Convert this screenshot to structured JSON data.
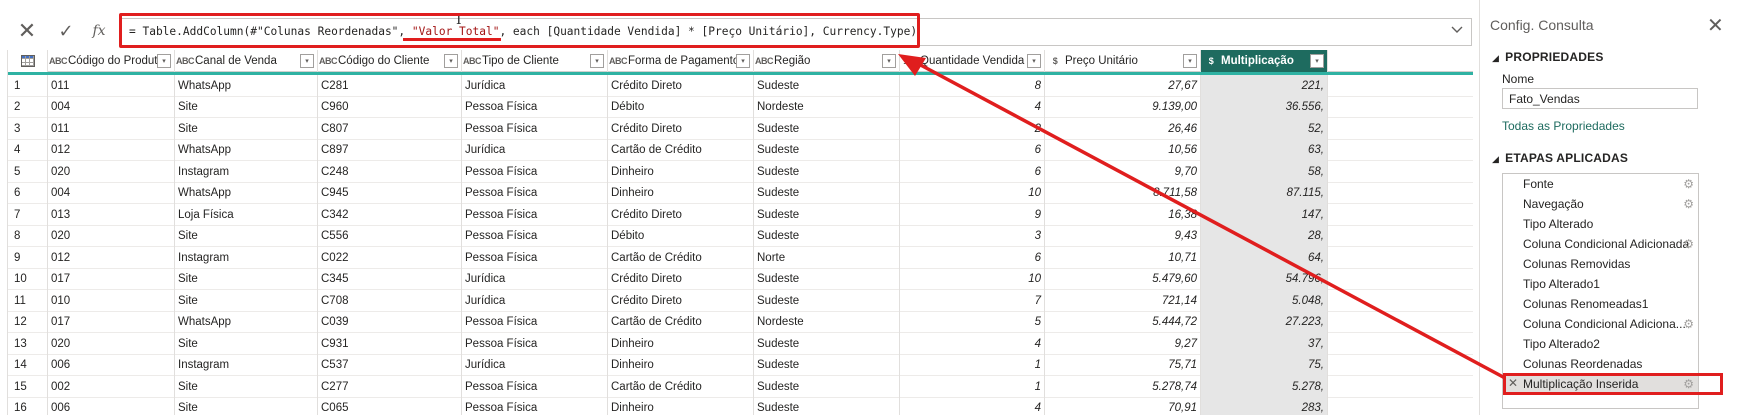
{
  "formula_bar": {
    "cancel_icon": "✕",
    "commit_icon": "✓",
    "fx_label": "fx",
    "formula_prefix": "= Table.AddColumn(#\"Colunas Reordenadas\", ",
    "formula_string": "\"Valor Total\"",
    "formula_suffix": ", each [Quantidade Vendida] * [Preço Unitário], Currency.Type)",
    "expand_icon": "chevron-down",
    "cursor_glyph": "I"
  },
  "grid": {
    "columns": [
      {
        "type": "ABC",
        "label": "Código do Produto"
      },
      {
        "type": "ABC",
        "label": "Canal de Venda"
      },
      {
        "type": "ABC",
        "label": "Código do Cliente"
      },
      {
        "type": "ABC",
        "label": "Tipo de Cliente"
      },
      {
        "type": "ABC",
        "label": "Forma de Pagamento"
      },
      {
        "type": "ABC",
        "label": "Região"
      },
      {
        "type": "123",
        "label": "Quantidade Vendida"
      },
      {
        "type": "$",
        "label": "Preço Unitário"
      },
      {
        "type": "$",
        "label": "Multiplicação"
      }
    ],
    "filter_glyph": "▾",
    "rows": [
      {
        "n": "1",
        "cells": [
          "011",
          "WhatsApp",
          "C281",
          "Jurídica",
          "Crédito Direto",
          "Sudeste",
          "8",
          "27,67",
          "221,"
        ]
      },
      {
        "n": "2",
        "cells": [
          "004",
          "Site",
          "C960",
          "Pessoa Física",
          "Débito",
          "Nordeste",
          "4",
          "9.139,00",
          "36.556,"
        ]
      },
      {
        "n": "3",
        "cells": [
          "011",
          "Site",
          "C807",
          "Pessoa Física",
          "Crédito Direto",
          "Sudeste",
          "2",
          "26,46",
          "52,"
        ]
      },
      {
        "n": "4",
        "cells": [
          "012",
          "WhatsApp",
          "C897",
          "Jurídica",
          "Cartão de Crédito",
          "Sudeste",
          "6",
          "10,56",
          "63,"
        ]
      },
      {
        "n": "5",
        "cells": [
          "020",
          "Instagram",
          "C248",
          "Pessoa Física",
          "Dinheiro",
          "Sudeste",
          "6",
          "9,70",
          "58,"
        ]
      },
      {
        "n": "6",
        "cells": [
          "004",
          "WhatsApp",
          "C945",
          "Pessoa Física",
          "Dinheiro",
          "Sudeste",
          "10",
          "8.711,58",
          "87.115,"
        ]
      },
      {
        "n": "7",
        "cells": [
          "013",
          "Loja Física",
          "C342",
          "Pessoa Física",
          "Crédito Direto",
          "Sudeste",
          "9",
          "16,38",
          "147,"
        ]
      },
      {
        "n": "8",
        "cells": [
          "020",
          "Site",
          "C556",
          "Pessoa Física",
          "Débito",
          "Sudeste",
          "3",
          "9,43",
          "28,"
        ]
      },
      {
        "n": "9",
        "cells": [
          "012",
          "Instagram",
          "C022",
          "Pessoa Física",
          "Cartão de Crédito",
          "Norte",
          "6",
          "10,71",
          "64,"
        ]
      },
      {
        "n": "10",
        "cells": [
          "017",
          "Site",
          "C345",
          "Jurídica",
          "Crédito Direto",
          "Sudeste",
          "10",
          "5.479,60",
          "54.796,"
        ]
      },
      {
        "n": "11",
        "cells": [
          "010",
          "Site",
          "C708",
          "Jurídica",
          "Crédito Direto",
          "Sudeste",
          "7",
          "721,14",
          "5.048,"
        ]
      },
      {
        "n": "12",
        "cells": [
          "017",
          "WhatsApp",
          "C039",
          "Pessoa Física",
          "Cartão de Crédito",
          "Nordeste",
          "5",
          "5.444,72",
          "27.223,"
        ]
      },
      {
        "n": "13",
        "cells": [
          "020",
          "Site",
          "C931",
          "Pessoa Física",
          "Dinheiro",
          "Sudeste",
          "4",
          "9,27",
          "37,"
        ]
      },
      {
        "n": "14",
        "cells": [
          "006",
          "Instagram",
          "C537",
          "Jurídica",
          "Dinheiro",
          "Sudeste",
          "1",
          "75,71",
          "75,"
        ]
      },
      {
        "n": "15",
        "cells": [
          "002",
          "Site",
          "C277",
          "Pessoa Física",
          "Cartão de Crédito",
          "Sudeste",
          "1",
          "5.278,74",
          "5.278,"
        ]
      },
      {
        "n": "16",
        "cells": [
          "006",
          "Site",
          "C065",
          "Pessoa Física",
          "Dinheiro",
          "Sudeste",
          "4",
          "70,91",
          "283,"
        ]
      }
    ]
  },
  "query_settings": {
    "title": "Config. Consulta",
    "close_icon": "✕",
    "properties_header": "PROPRIEDADES",
    "name_label": "Nome",
    "name_value": "Fato_Vendas",
    "all_properties_link": "Todas as Propriedades",
    "applied_steps_header": "ETAPAS APLICADAS",
    "steps": [
      {
        "label": "Fonte",
        "gear": true
      },
      {
        "label": "Navegação",
        "gear": true
      },
      {
        "label": "Tipo Alterado",
        "gear": false
      },
      {
        "label": "Coluna Condicional Adicionada",
        "gear": true
      },
      {
        "label": "Colunas Removidas",
        "gear": false
      },
      {
        "label": "Tipo Alterado1",
        "gear": false
      },
      {
        "label": "Colunas Renomeadas1",
        "gear": false
      },
      {
        "label": "Coluna Condicional Adiciona...",
        "gear": true
      },
      {
        "label": "Tipo Alterado2",
        "gear": false
      },
      {
        "label": "Colunas Reordenadas",
        "gear": false
      },
      {
        "label": "Multiplicação Inserida",
        "gear": true,
        "active": true
      }
    ]
  },
  "colors": {
    "selected_header": "#1e6b5f",
    "quality_bar": "#2fb2a3",
    "annotation_red": "#e01e1e",
    "selected_column_bg": "#e6e6e6"
  }
}
